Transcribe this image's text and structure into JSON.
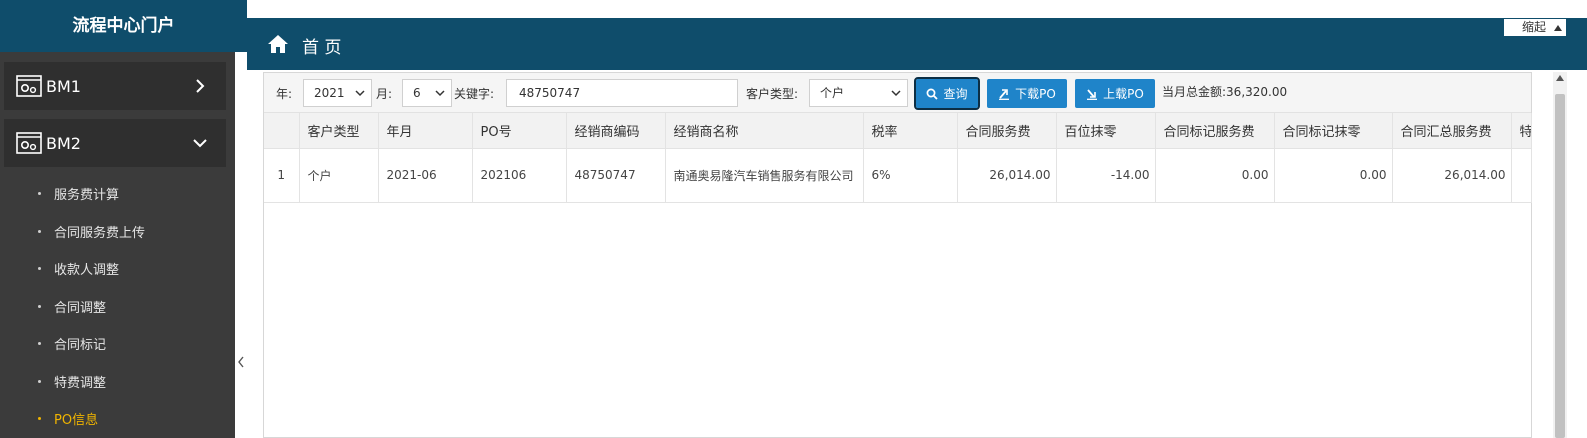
{
  "sidebar": {
    "title": "流程中心门户",
    "groups": [
      {
        "label": "BM1",
        "expanded": false
      },
      {
        "label": "BM2",
        "expanded": true
      }
    ],
    "items": [
      {
        "label": "服务费计算"
      },
      {
        "label": "合同服务费上传"
      },
      {
        "label": "收款人调整"
      },
      {
        "label": "合同调整"
      },
      {
        "label": "合同标记"
      },
      {
        "label": "特费调整"
      },
      {
        "label": "PO信息",
        "active": true
      }
    ]
  },
  "header": {
    "title": "首 页",
    "shrink_label": "缩起"
  },
  "toolbar": {
    "year_label": "年:",
    "year_value": "2021",
    "month_label": "月:",
    "month_value": "6",
    "keyword_label": "关键字:",
    "keyword_value": "48750747",
    "customer_type_label": "客户类型:",
    "customer_type_value": "个户",
    "search_label": "查询",
    "download_label": "下载PO",
    "upload_label": "上载PO",
    "total_text": "当月总金额:36,320.00"
  },
  "table": {
    "columns": [
      "",
      "客户类型",
      "年月",
      "PO号",
      "经销商编码",
      "经销商名称",
      "税率",
      "合同服务费",
      "百位抹零",
      "合同标记服务费",
      "合同标记抹零",
      "合同汇总服务费",
      "特"
    ],
    "rows": [
      [
        "1",
        "个户",
        "2021-06",
        "202106",
        "48750747",
        "南通奥易隆汽车销售服务有限公司",
        "6%",
        "26,014.00",
        "-14.00",
        "0.00",
        "0.00",
        "26,014.00",
        ""
      ]
    ]
  },
  "colors": {
    "brand": "#0f4d6b",
    "sidebar_bg": "#3b3b3b",
    "button": "#1f84c9",
    "active_item": "#f0b400"
  },
  "icons": [
    "settings-window-icon",
    "chevron-right-icon",
    "chevron-down-icon",
    "home-icon",
    "search-icon",
    "download-icon",
    "upload-icon"
  ]
}
